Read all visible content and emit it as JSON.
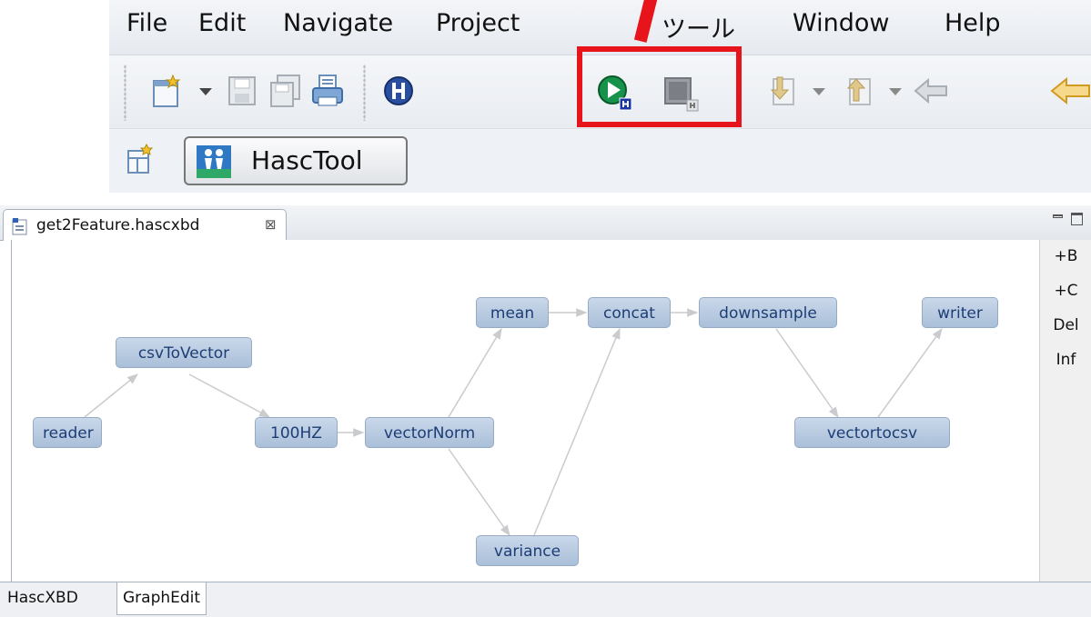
{
  "menubar": {
    "items": [
      "File",
      "Edit",
      "Navigate",
      "Project",
      "ツール",
      "Window",
      "Help"
    ]
  },
  "toolbar": {
    "icons": [
      "new-wizard-icon",
      "save-icon",
      "save-all-icon",
      "print-icon",
      "hasc-h-icon",
      "run-hasc-icon",
      "stop-hasc-icon",
      "next-annotation-icon",
      "previous-annotation-icon",
      "back-icon",
      "forward-icon"
    ]
  },
  "perspective": {
    "label": "HascTool"
  },
  "editor": {
    "tab_title": "get2Feature.hascxbd",
    "close_glyph": "⊠"
  },
  "graph": {
    "nodes": [
      "reader",
      "csvToVector",
      "100HZ",
      "vectorNorm",
      "mean",
      "variance",
      "concat",
      "downsample",
      "vectortocsv",
      "writer"
    ]
  },
  "sidepanel": {
    "items": [
      "+B",
      "+C",
      "Del",
      "Inf"
    ]
  },
  "bottom_tabs": [
    "HascXBD",
    "GraphEdit"
  ],
  "colors": {
    "highlight": "#e8141c",
    "node_text": "#1c3d75",
    "node_fill": "#b8cbe2"
  }
}
